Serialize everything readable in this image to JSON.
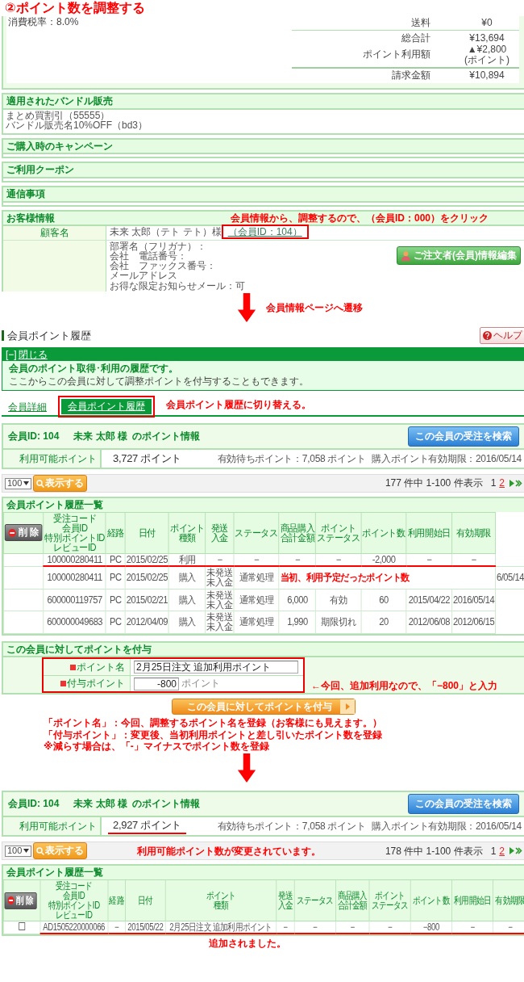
{
  "title": "②ポイント数を調整する",
  "order_summary": {
    "tax_rate": "消費税率：8.0%",
    "rows": [
      {
        "kind": "divided",
        "label": "送料",
        "value": "¥0"
      },
      {
        "kind": "plain",
        "label": "総合計",
        "value": "¥13,694"
      },
      {
        "kind": "plain",
        "label": "ポイント利用額",
        "value": "▲¥2,800",
        "note": "(ポイント)"
      },
      {
        "kind": "total",
        "label": "請求金額",
        "value": "¥10,894"
      }
    ]
  },
  "sections": [
    {
      "title": "適用されたバンドル販売",
      "lines": [
        "まとめ買割引（55555）",
        "バンドル販売名10%OFF（bd3）"
      ]
    },
    {
      "title": "ご購入時のキャンペーン"
    },
    {
      "title": "ご利用クーポン"
    },
    {
      "title": "通信事項"
    }
  ],
  "customer_info": {
    "title": "お客様情報",
    "annotation": "会員情報から、調整するので、（会員ID：000）をクリック",
    "name_label": "顧客名",
    "name": "未来 太郎（テト テト）様",
    "member_link": "（会員ID：104）",
    "highlight": true,
    "details": [
      "部署名（フリガナ）：",
      "会社　電話番号：",
      "会社　ファックス番号：",
      "メールアドレス",
      "お得な限定お知らせメール：可"
    ],
    "edit_button": "ご注文者(会員)情報編集"
  },
  "step_1": "会員情報ページへ遷移",
  "member_page": {
    "heading": "会員ポイント履歴",
    "help_button": "ヘルプ",
    "notice": {
      "toggle": "[−]",
      "close_link": "閉じる",
      "title": "会員のポイント取得･利用の履歴です。",
      "text": "ここからこの会員に対して調整ポイントを付与することもできます。"
    },
    "tabs": [
      {
        "label": "会員詳細",
        "selected": false,
        "highlight": false
      },
      {
        "label": "会員ポイント履歴",
        "selected": true,
        "highlight": true
      }
    ],
    "tab_annotation": "会員ポイント履歴に切り替える。"
  },
  "before": {
    "point_info": {
      "member": "会員ID: 104",
      "name": "未来 太郎 様",
      "title": "のポイント情報",
      "search_button": "この会員の受注を検索",
      "available_label": "利用可能ポイント",
      "available": "3,727 ポイント",
      "underlined": false,
      "pending": "有効待ちポイント：7,058 ポイント",
      "expiry": "購入ポイント有効期限：2016/05/14"
    },
    "pager": {
      "per_page": "100",
      "show_button": "表示する",
      "summary": "177 件中 1-100 件表示",
      "pages": [
        {
          "label": "1",
          "selected": true
        },
        {
          "label": "2",
          "selected": false
        }
      ]
    },
    "history": {
      "title": "会員ポイント履歴一覧",
      "delete_button": "削 除",
      "columns": [
        {
          "lines": [
            "受注コード",
            "会員ID",
            "特別ポイントID",
            "レビューID"
          ]
        },
        "経路",
        "日付",
        {
          "lines": [
            "ポイント",
            "種類"
          ]
        },
        {
          "lines": [
            "発送",
            "入金"
          ]
        },
        "ステータス",
        {
          "lines": [
            "商品購入",
            "合計金額"
          ]
        },
        {
          "lines": [
            "ポイント",
            "ステータス"
          ]
        },
        "ポイント数",
        "利用開始日",
        "有効期限"
      ],
      "rows": [
        {
          "kind": "plain",
          "underlined": true,
          "cells": [
            "100000280411",
            "PC",
            "2015/02/25",
            "利用",
            "−",
            "−",
            "−",
            "−",
            "-2,000",
            "−",
            "−"
          ]
        },
        {
          "kind": "annotated",
          "underlined": false,
          "cells": [
            "100000280411",
            "PC",
            "2015/02/25",
            "購入",
            [
              "未発送",
              "未入金"
            ],
            "通常処理"
          ],
          "note": "当初、利用予定だったポイント数",
          "tail": "6/05/14"
        },
        {
          "kind": "plain",
          "underlined": false,
          "cells": [
            "600000119757",
            "PC",
            "2015/02/21",
            "購入",
            [
              "未発送",
              "未入金"
            ],
            "通常処理",
            "6,000",
            "有効",
            "60",
            "2015/04/22",
            "2016/05/14"
          ]
        },
        {
          "kind": "plain",
          "underlined": false,
          "cells": [
            "600000049683",
            "PC",
            "2012/04/09",
            "購入",
            [
              "未発送",
              "未入金"
            ],
            "通常処理",
            "1,990",
            "期限切れ",
            "20",
            "2012/06/08",
            "2012/06/15"
          ]
        }
      ]
    }
  },
  "grant_form": {
    "title": "この会員に対してポイントを付与",
    "highlight": true,
    "fields": [
      {
        "label": "ポイント名",
        "value": "2月25日注文 追加利用ポイント"
      },
      {
        "label": "付与ポイント",
        "value": "-800",
        "unit": "ポイント",
        "note": "←今回、追加利用なので、「−800」と入力"
      }
    ],
    "submit": "この会員に対してポイントを付与"
  },
  "instructions": [
    "「ポイント名」：今回、調整するポイント名を登録（お客様にも見えます。）",
    "「付与ポイント」：変更後、当初利用ポイントと差し引いたポイント数を登録",
    "※減らす場合は、「-」マイナスでポイント数を登録"
  ],
  "after": {
    "point_info": {
      "member": "会員ID: 104",
      "name": "未来 太郎 様",
      "title": "のポイント情報",
      "search_button": "この会員の受注を検索",
      "available_label": "利用可能ポイント",
      "available": "2,927 ポイント",
      "underlined": true,
      "pending": "有効待ちポイント：7,058 ポイント",
      "expiry": "購入ポイント有効期限：2016/05/14"
    },
    "pager": {
      "per_page": "100",
      "show_button": "表示する",
      "annotation": "利用可能ポイント数が変更されています。",
      "summary": "178 件中 1-100 件表示",
      "pages": [
        {
          "label": "1",
          "selected": true
        },
        {
          "label": "2",
          "selected": false
        }
      ]
    },
    "history": {
      "title": "会員ポイント履歴一覧",
      "delete_button": "削 除",
      "columns": [
        {
          "lines": [
            "受注コード",
            "会員ID",
            "特別ポイントID",
            "レビューID"
          ]
        },
        "経路",
        "日付",
        {
          "lines": [
            "ポイント",
            "種類"
          ]
        },
        {
          "lines": [
            "発送",
            "入金"
          ]
        },
        "ステータス",
        {
          "lines": [
            "商品購入",
            "合計金額"
          ]
        },
        {
          "lines": [
            "ポイント",
            "ステータス"
          ]
        },
        "ポイント数",
        "利用開始日",
        "有効期限"
      ],
      "rows": [
        {
          "kind": "selectable",
          "checked": false,
          "underlined": true,
          "cells": [
            "AD1505220000066",
            "−",
            "2015/05/22",
            "2月25日注文 追加利用ポイント",
            "−",
            "−",
            "−",
            "−",
            "−800",
            "−",
            "−"
          ]
        }
      ]
    },
    "result_note": "追加されました。"
  }
}
